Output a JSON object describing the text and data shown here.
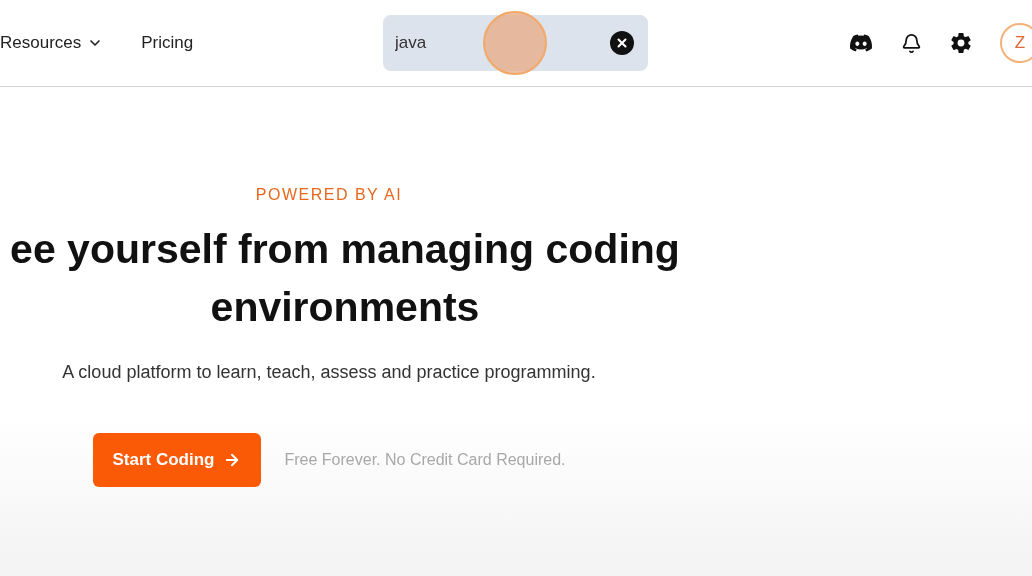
{
  "nav": {
    "items": [
      {
        "label": "Resources",
        "kind": "dropdown"
      },
      {
        "label": "Pricing",
        "kind": "link"
      }
    ]
  },
  "search": {
    "value": "java"
  },
  "avatar": {
    "initial": "Z"
  },
  "hero": {
    "eyebrow": "POWERED BY AI",
    "headline": "ee yourself from managing coding environments",
    "subtitle": "A cloud platform to learn, teach, assess and practice programming.",
    "cta": "Start Coding",
    "note": "Free Forever. No Credit Card Required."
  }
}
